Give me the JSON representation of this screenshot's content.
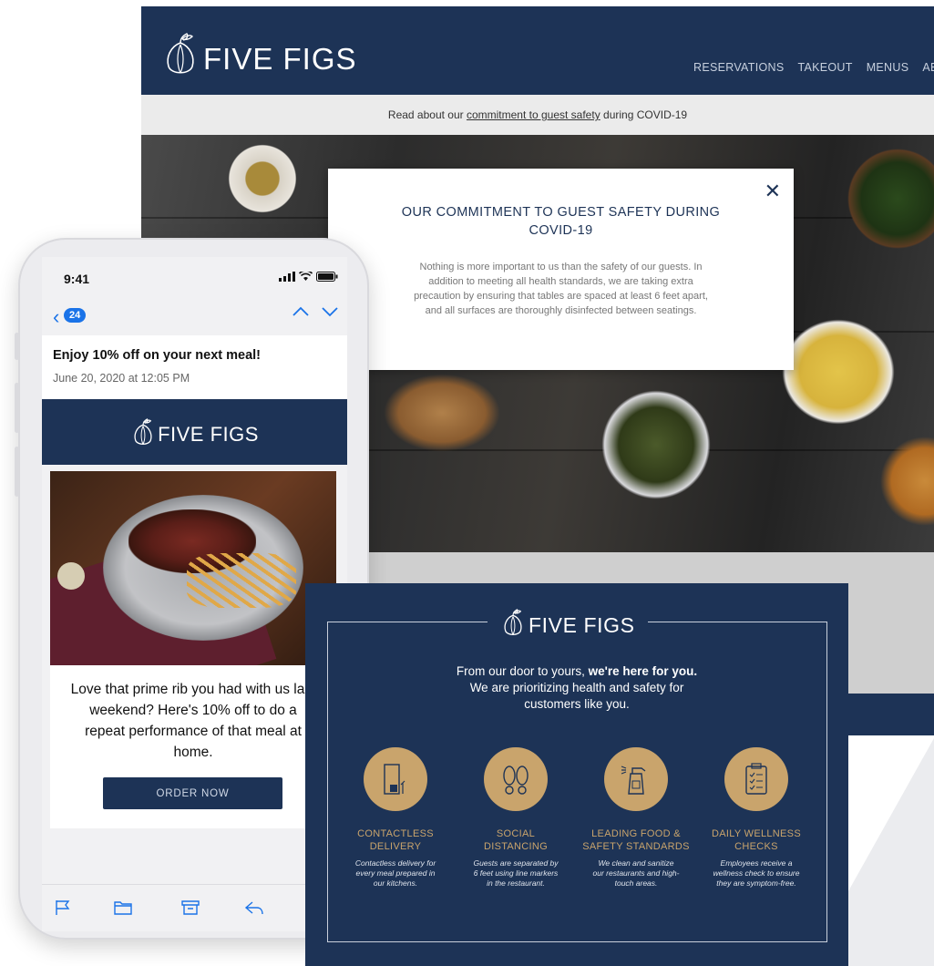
{
  "brand": {
    "name": "FIVE FIGS",
    "navy": "#1d3356",
    "gold": "#c9a46c"
  },
  "website": {
    "nav": [
      "RESERVATIONS",
      "TAKEOUT",
      "MENUS",
      "ABO"
    ],
    "notice": {
      "prefix": "Read about our ",
      "link": "commitment to guest safety",
      "suffix": " during COVID-19"
    },
    "modal": {
      "close_icon": "close-icon",
      "title": "OUR COMMITMENT TO GUEST SAFETY DURING COVID-19",
      "body": "Nothing is more important to us than the safety of our guests. In addition to meeting all health standards, we are taking extra precaution by ensuring that tables are spaced at least 6 feet apart, and all surfaces are thoroughly disinfected between seatings."
    }
  },
  "phone": {
    "status_time": "9:41",
    "unread_count": "24",
    "email": {
      "subject": "Enjoy 10% off on your next meal!",
      "date": "June 20, 2020 at 12:05 PM",
      "body": "Love that prime rib you had with us last weekend? Here's 10% off to do a repeat performance of that meal at home.",
      "cta": "ORDER NOW"
    },
    "toolbar_icons": [
      "flag-icon",
      "folder-icon",
      "archive-icon",
      "reply-icon"
    ]
  },
  "flyer": {
    "intro_line1_prefix": "From our door to yours, ",
    "intro_line1_bold": "we're here for you.",
    "intro_line2": "We are prioritizing health and safety for",
    "intro_line3": "customers like you.",
    "features": [
      {
        "icon": "door-package-icon",
        "title_1": "CONTACTLESS",
        "title_2": "DELIVERY",
        "desc_1": "Contactless delivery for",
        "desc_2": "every meal prepared in",
        "desc_3": "our kitchens."
      },
      {
        "icon": "footprints-icon",
        "title_1": "SOCIAL",
        "title_2": "DISTANCING",
        "desc_1": "Guests are separated by",
        "desc_2": "6 feet using line markers",
        "desc_3": "in the restaurant."
      },
      {
        "icon": "spray-bottle-icon",
        "title_1": "LEADING FOOD &",
        "title_2": "SAFETY STANDARDS",
        "desc_1": "We clean and sanitize",
        "desc_2": "our restaurants and high-",
        "desc_3": "touch areas."
      },
      {
        "icon": "clipboard-checklist-icon",
        "title_1": "DAILY WELLNESS",
        "title_2": "CHECKS",
        "desc_1": "Employees receive a",
        "desc_2": "wellness check to ensure",
        "desc_3": "they are symptom-free."
      }
    ]
  }
}
